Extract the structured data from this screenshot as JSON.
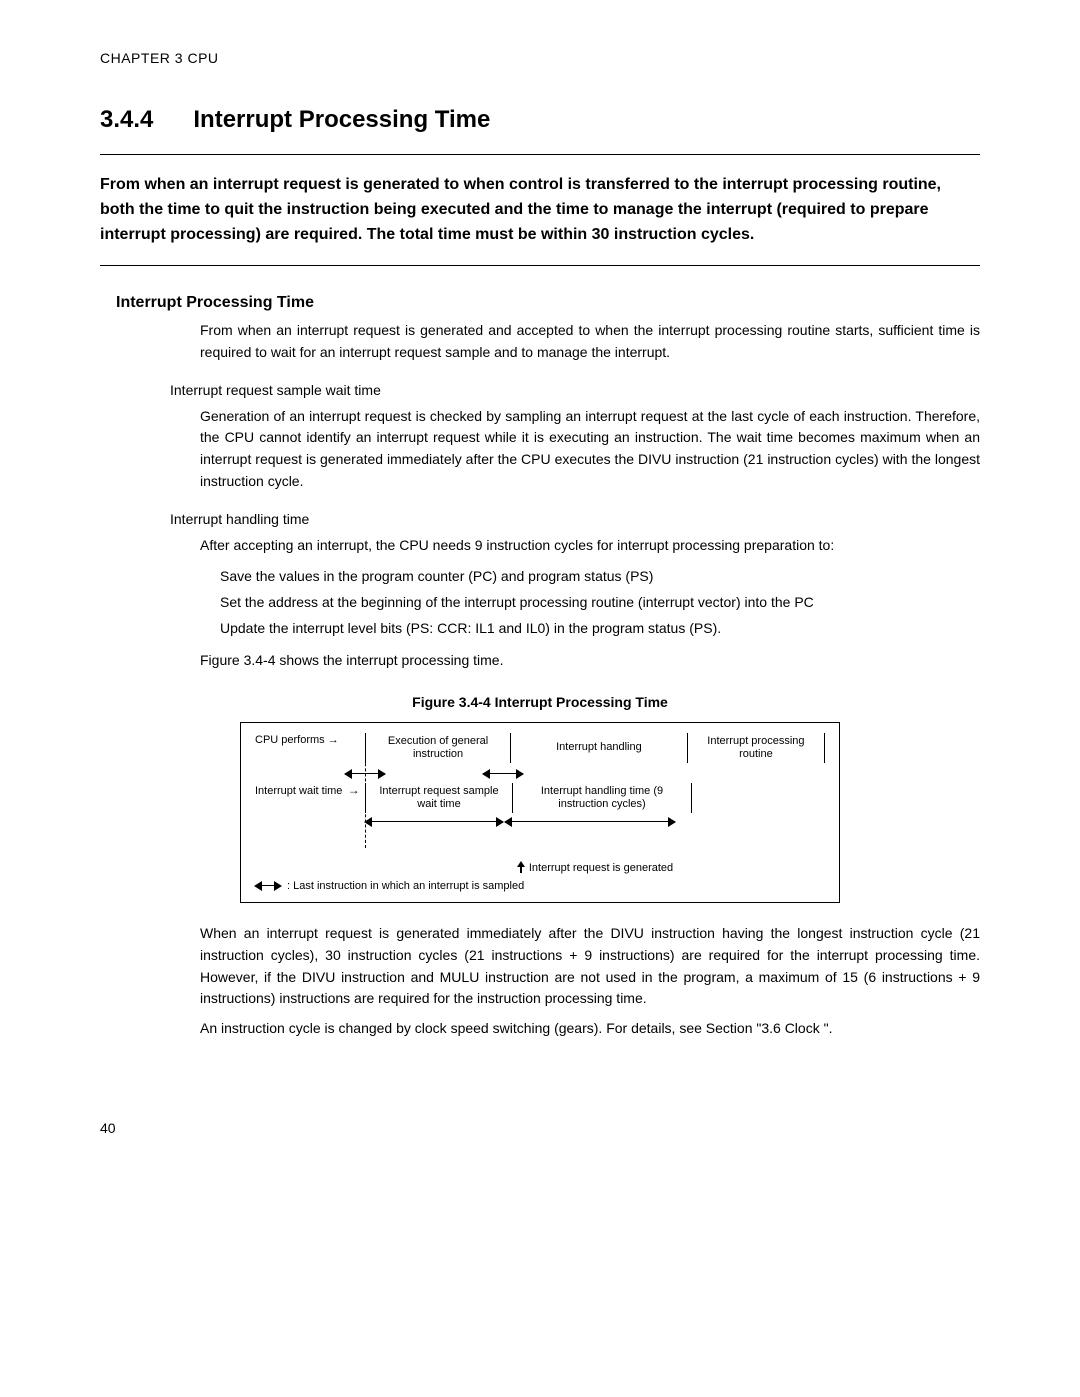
{
  "chapter_header": "CHAPTER 3  CPU",
  "section_number": "3.4.4",
  "section_title": "Interrupt Processing Time",
  "intro": "From when an interrupt request is generated to when control is transferred to the interrupt processing routine, both the time to quit the instruction being executed and the time to manage the interrupt (required to prepare interrupt processing) are required. The total time must be within 30 instruction cycles.",
  "sub_heading": "Interrupt Processing Time",
  "para_overview": "From when an interrupt request is generated and accepted to when the interrupt processing routine starts, sufficient time is required to wait for an interrupt request sample and to manage the interrupt.",
  "bullet1_heading": "Interrupt request sample wait time",
  "bullet1_para": "Generation of an interrupt request is checked by sampling an interrupt request at the last cycle of each instruction. Therefore, the CPU cannot identify an interrupt request while it is executing an instruction. The wait time becomes maximum when an interrupt request is generated immediately after the CPU executes the DIVU instruction (21 instruction cycles) with the longest instruction cycle.",
  "bullet2_heading": "Interrupt handling time",
  "bullet2_intro": "After accepting an interrupt, the CPU needs 9 instruction cycles for interrupt processing preparation to:",
  "actions": {
    "a1": "Save the values in the program counter (PC) and program status (PS)",
    "a2": "Set the address at the beginning of the interrupt processing routine (interrupt vector) into the PC",
    "a3": "Update the interrupt level bits (PS: CCR: IL1 and IL0) in the program status (PS)."
  },
  "figure_ref_line": "Figure 3.4-4 shows the interrupt processing time.",
  "figure_caption": "Figure 3.4-4  Interrupt Processing Time",
  "figure": {
    "row1_label": "CPU performs →",
    "row1_seg1": "Execution of general instruction",
    "row1_seg2": "Interrupt handling",
    "row1_seg3": "Interrupt processing routine",
    "row2_label": "Interrupt wait time",
    "row2_seg1": "Interrupt request sample wait time",
    "row2_seg2": "Interrupt handling time (9 instruction cycles)",
    "gen_label": "Interrupt request is generated",
    "legend": ": Last instruction in which an interrupt is sampled"
  },
  "closing_para1": "When an interrupt request is generated immediately after the DIVU instruction having the longest instruction cycle (21 instruction cycles), 30 instruction cycles (21 instructions + 9 instructions) are required for the interrupt processing time. However, if the DIVU instruction and MULU instruction are not used in the program, a maximum of 15 (6 instructions + 9 instructions) instructions are required for the instruction processing time.",
  "closing_para2": "An instruction cycle is changed by clock speed switching (gears). For details, see Section \"3.6  Clock \".",
  "page_number": "40"
}
